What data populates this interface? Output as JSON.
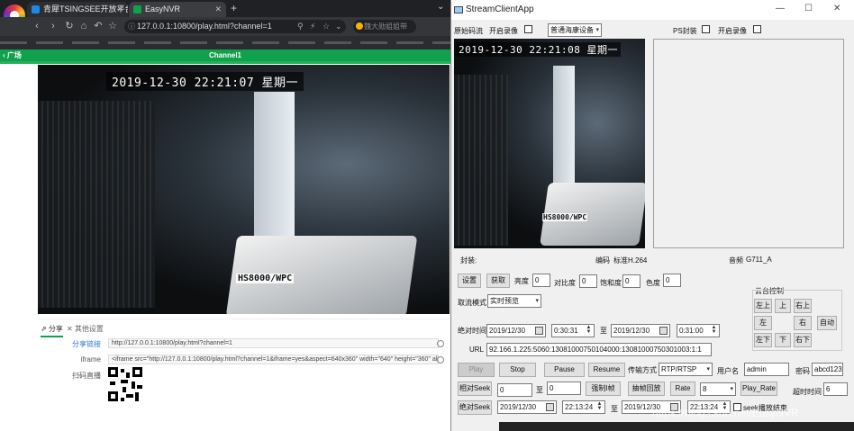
{
  "browser": {
    "tabs": [
      {
        "title": "青犀TSINGSEE开放平台",
        "color": "#1e88e5"
      },
      {
        "title": "EasyNVR",
        "color": "#0fa14b"
      }
    ],
    "url": "127.0.0.1:10800/play.html?channel=1",
    "search_placeholder": "魏大勋姐姐带",
    "new_tab": "+",
    "back_label": "广场",
    "channel_title": "Channel1",
    "osd_time": "2019-12-30 22:21:07 星期一",
    "cam_label": "HS8000/WPC",
    "panel": {
      "tab_share": "分享",
      "tab_other": "其他设置",
      "share_link_label": "分享链接",
      "share_link_value": "http://127.0.0.1:10800/play.html?channel=1",
      "iframe_label": "iframe",
      "iframe_value": "<iframe src=\"http://127.0.0.1:10800/play.html?channel=1&iframe=yes&aspect=640x360\" width=\"640\" height=\"360\" allowfullscreen allo",
      "qr_label": "扫码直播"
    }
  },
  "app": {
    "title": "StreamClientApp",
    "window_buttons": {
      "minimize": "—",
      "maximize": "☐",
      "close": "✕"
    },
    "raw_stream_label": "原始码流",
    "record_label_1": "开启录像",
    "device_select": "普通海康设备",
    "ps_label": "PS封装",
    "record_label_2": "开启录像",
    "osd_time": "2019-12-30 22:21:08 星期一",
    "cam_label": "HS8000/WPC",
    "encap_label": "封装:",
    "codec_label": "编码",
    "codec_value": "标准H.264",
    "audio_label": "音频",
    "audio_value": "G711_A",
    "settings_button": "设置",
    "get_button": "获取",
    "brightness_label": "亮度",
    "brightness_value": "0",
    "contrast_label": "对比度",
    "contrast_value": "0",
    "saturation_label": "饱和度",
    "saturation_value": "0",
    "hue_label": "色度",
    "hue_value": "0",
    "ptz": {
      "title": "云台控制",
      "up_left": "左上",
      "up": "上",
      "up_right": "右上",
      "left": "左",
      "right": "右",
      "auto": "自动",
      "down_left": "左下",
      "down": "下",
      "down_right": "右下"
    },
    "stream_mode_label": "取流模式",
    "stream_mode_value": "实时预览",
    "abs_time_label": "绝对时间",
    "abs_date_start": "2019/12/30",
    "abs_time_start": "0:30:31",
    "to_1": "至",
    "abs_date_end": "2019/12/30",
    "abs_time_end": "0:31:00",
    "url_label": "URL",
    "url_value": "92.166.1.225:5060:13081000750104000:13081000750301003:1:1",
    "play_button": "Play",
    "stop_button": "Stop",
    "pause_button": "Pause",
    "resume_button": "Resume",
    "transport_label": "传输方式",
    "transport_value": "RTP/RTSP",
    "username_label": "用户名",
    "username_value": "admin",
    "password_label": "密码",
    "password_value": "abcd123",
    "rel_seek_button": "相对Seek",
    "rel_seek_from": "0",
    "to_2": "至",
    "rel_seek_to": "0",
    "force_i_button": "强制I帧",
    "frame_play_button": "抽帧回放",
    "rate_button": "Rate",
    "rate_value": "8",
    "play_rate_button": "Play_Rate",
    "timeout_label": "超时时间",
    "timeout_value": "6",
    "abs_seek_button": "绝对Seek",
    "seek_date_start": "2019/12/30",
    "seek_time_start": "22:13:24",
    "to_3": "至",
    "seek_date_end": "2019/12/30",
    "seek_time_end": "22:13:24",
    "seek_stop_label": "seek播放结束",
    "watermark": "https://blog.csdn.net/EasyNVR"
  }
}
